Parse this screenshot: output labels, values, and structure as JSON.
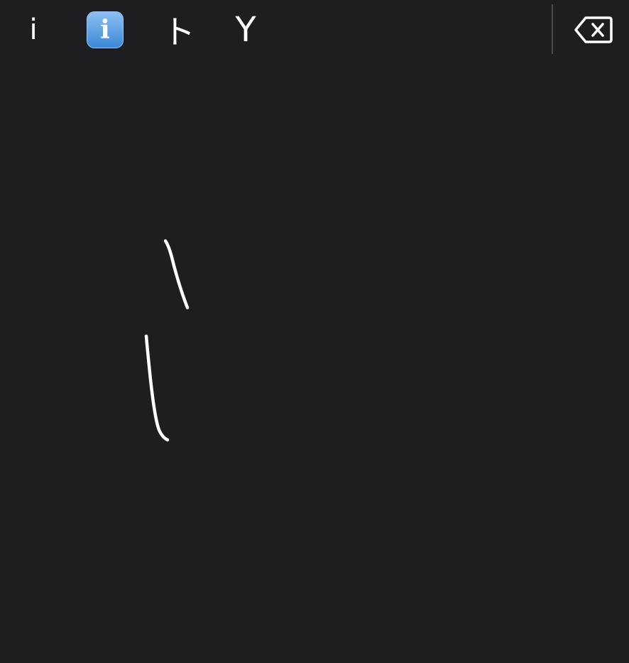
{
  "candidates": [
    {
      "label": "i"
    },
    {
      "label": "i",
      "style": "emoji"
    },
    {
      "label": "ト"
    },
    {
      "label": "Y"
    }
  ],
  "delete": {
    "icon": "delete-backspace-icon"
  },
  "colors": {
    "background": "#1e1d20",
    "stroke": "#ffffff",
    "emoji_blue": "#3c88d8"
  }
}
